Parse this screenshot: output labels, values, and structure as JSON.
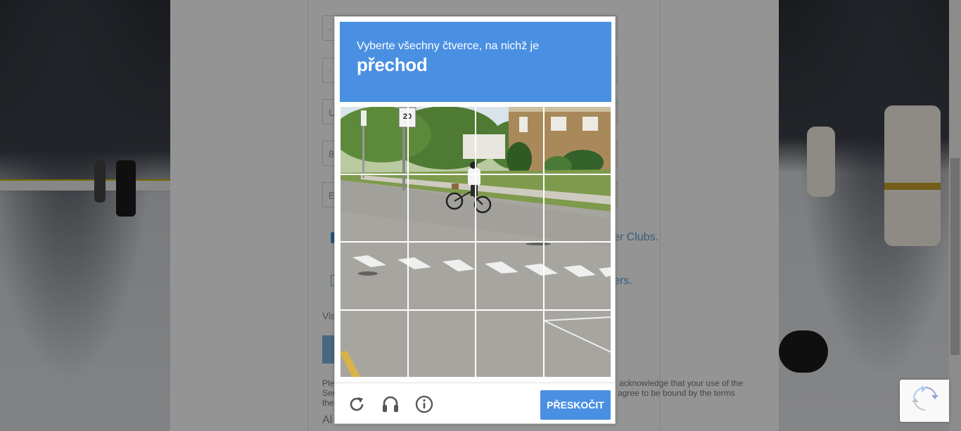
{
  "background_page": {
    "field_hints": [
      "·",
      "·",
      "U",
      "8",
      "E"
    ],
    "consent_text_1": "er Clubs.",
    "consent_text_2": "ers.",
    "visit_text": "Vis",
    "legal_left_1": "Ple",
    "legal_left_2": "Ser",
    "legal_left_3": "the",
    "legal_right_1": "acknowledge that your use of the",
    "legal_right_2": "agree to be bound by the terms",
    "bottom_text": "Al"
  },
  "captcha": {
    "instruction": "Vyberte všechny čtverce, na nichž je",
    "target": "přechod",
    "sign_text": "20",
    "skip_label": "PŘESKOČIT",
    "icons": [
      "reload-icon",
      "audio-icon",
      "info-icon"
    ],
    "accent_color": "#4a90e2"
  }
}
